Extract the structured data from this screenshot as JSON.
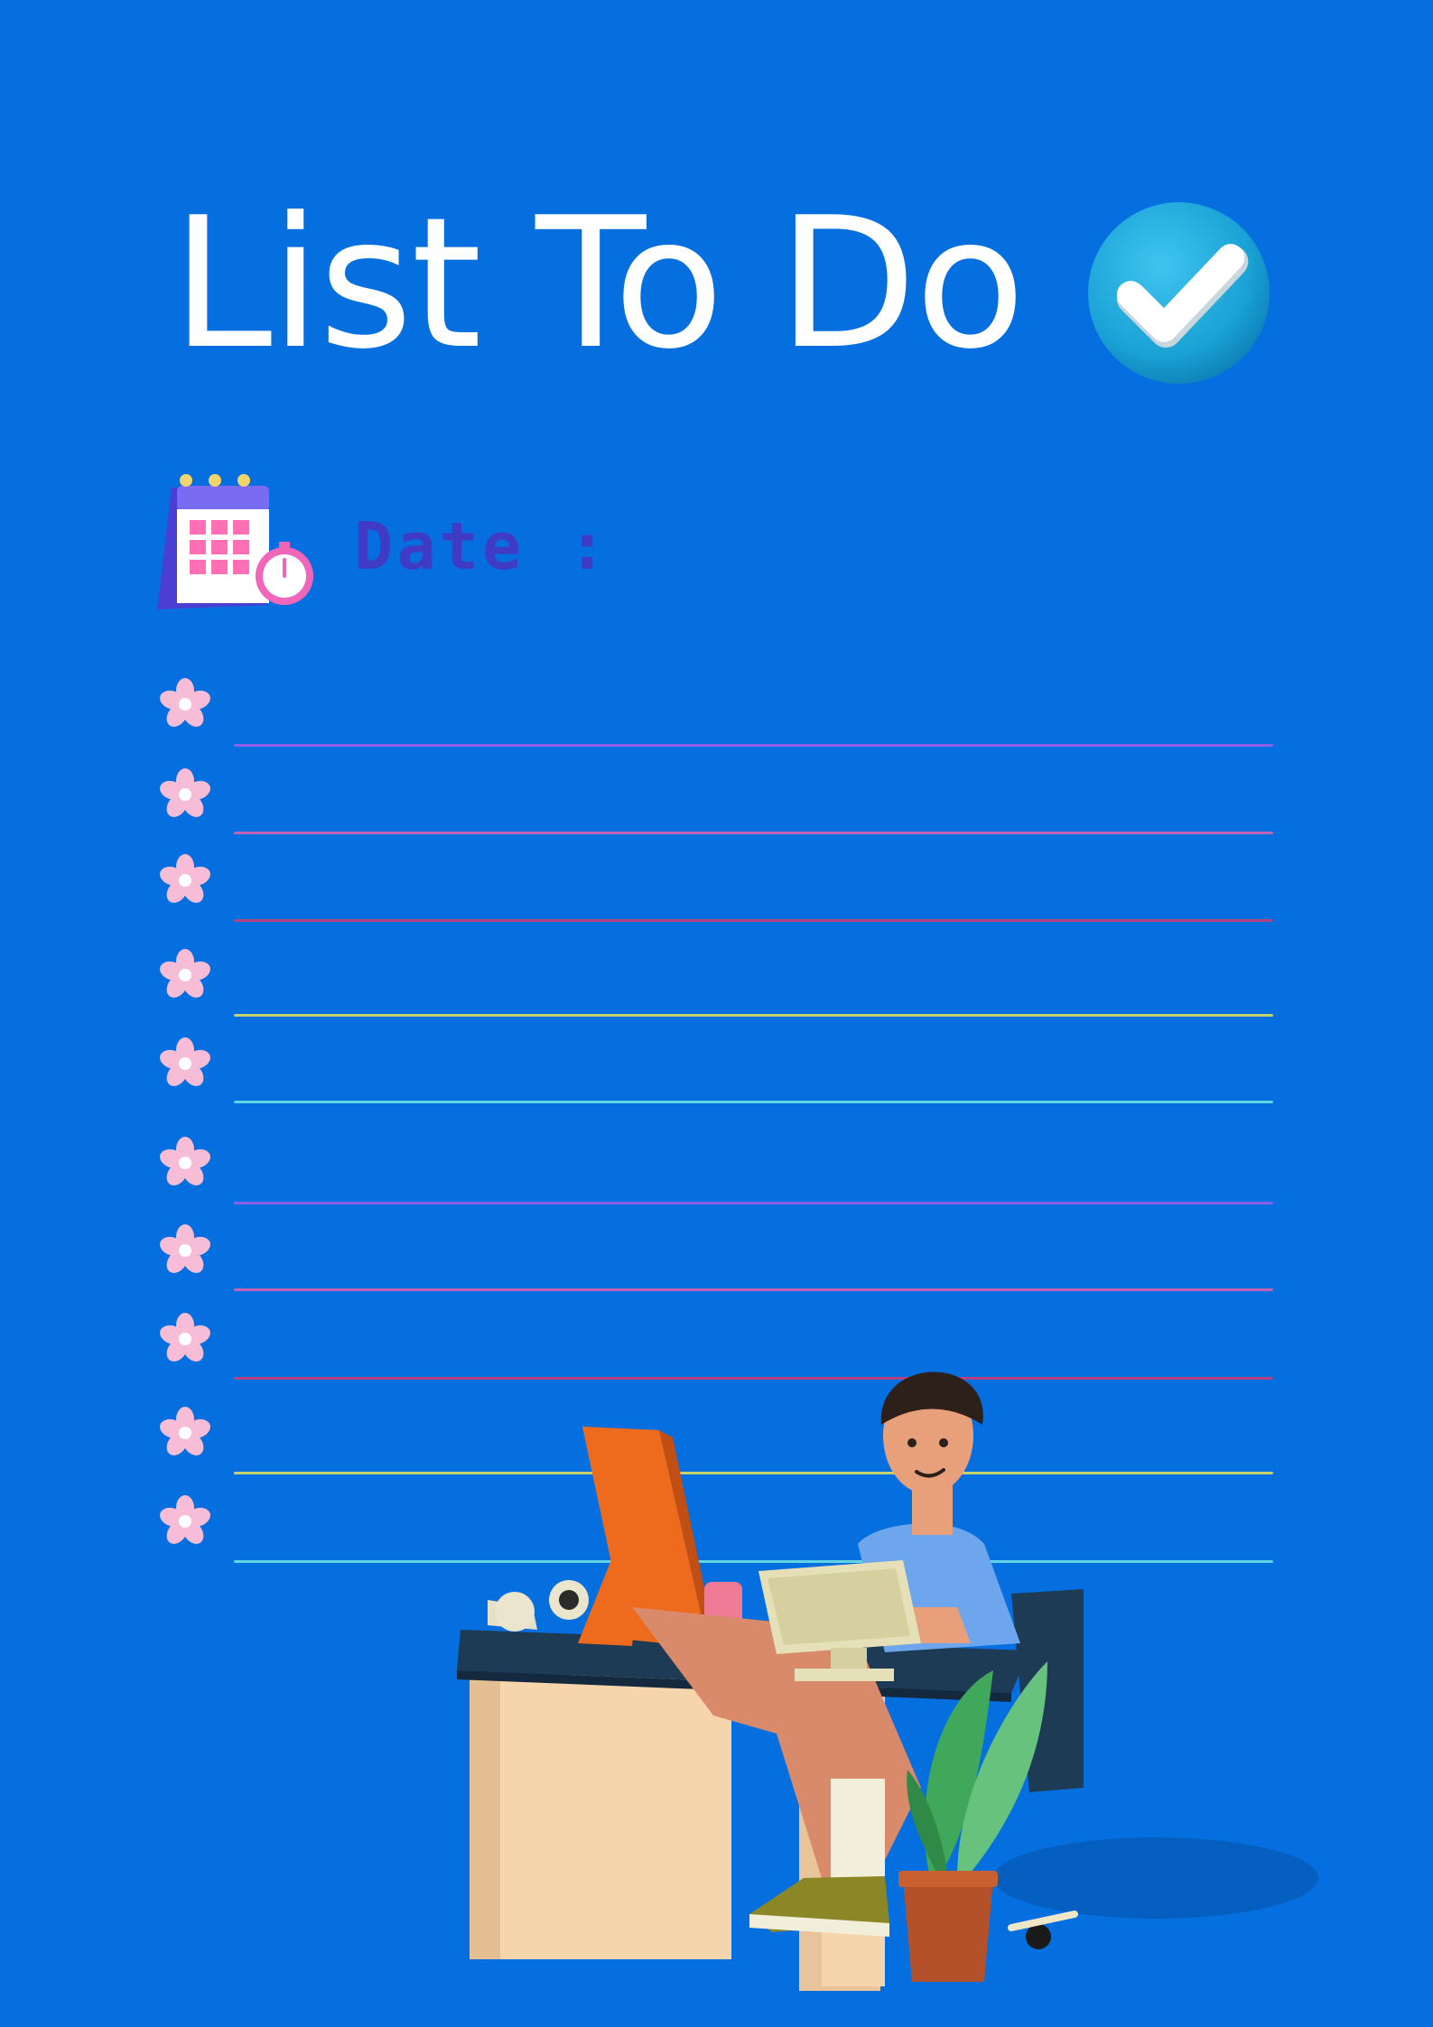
{
  "title": "List To Do",
  "date_label": "Date :",
  "colors": {
    "background": "#066fe0",
    "title": "#ffffff",
    "date": "#3f3bc4",
    "flower": "#f7bdd6"
  },
  "icons": {
    "title_badge": "check-icon",
    "date": "calendar-clock-icon",
    "bullet": "flower-icon",
    "illustration": "person-at-desk-illustration"
  },
  "list": {
    "items": [
      {
        "text": "",
        "line_color": "#8d5fe8"
      },
      {
        "text": "",
        "line_color": "#c062b6"
      },
      {
        "text": "",
        "line_color": "#b5417f"
      },
      {
        "text": "",
        "line_color": "#c6d36c"
      },
      {
        "text": "",
        "line_color": "#62d2e6"
      },
      {
        "text": "",
        "line_color": "#8d5fe8"
      },
      {
        "text": "",
        "line_color": "#c062b6"
      },
      {
        "text": "",
        "line_color": "#b5417f"
      },
      {
        "text": "",
        "line_color": "#c6d36c"
      },
      {
        "text": "",
        "line_color": "#62d2e6"
      }
    ]
  }
}
